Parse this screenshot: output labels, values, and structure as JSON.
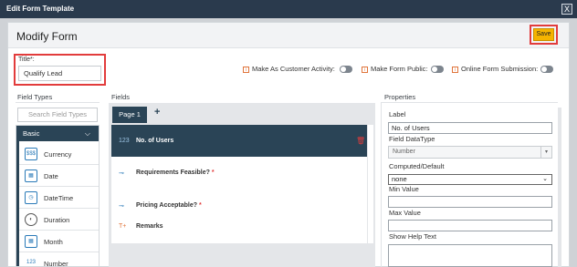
{
  "window": {
    "title": "Edit Form Template",
    "close_glyph": "X"
  },
  "header": {
    "page_title": "Modify Form",
    "save_label": "Save"
  },
  "form_title": {
    "label": "Title*:",
    "value": "Qualify Lead"
  },
  "options": [
    {
      "label": "Make As Customer Activity:",
      "icon": "info-icon",
      "enabled": false
    },
    {
      "label": "Make Form Public:",
      "icon": "info-icon",
      "enabled": false
    },
    {
      "label": "Online Form Submission:",
      "icon": "info-icon",
      "enabled": false
    }
  ],
  "field_types": {
    "title": "Field Types",
    "search_placeholder": "Search Field Types",
    "group_label": "Basic",
    "items": [
      {
        "label": "Currency",
        "icon": "currency-icon",
        "glyph": "$$$"
      },
      {
        "label": "Date",
        "icon": "calendar-icon",
        "glyph": "▦"
      },
      {
        "label": "DateTime",
        "icon": "clock-icon",
        "glyph": "◷"
      },
      {
        "label": "Duration",
        "icon": "duration-icon",
        "glyph": "◐"
      },
      {
        "label": "Month",
        "icon": "month-calendar-icon",
        "glyph": "▦"
      },
      {
        "label": "Number",
        "icon": "number-icon",
        "glyph": "123"
      }
    ]
  },
  "fields": {
    "title": "Fields",
    "page_tab": "Page 1",
    "add_glyph": "+",
    "rows": [
      {
        "label": "No. of Users",
        "icon_text": "123",
        "required": false,
        "selected": true
      },
      {
        "label": "Requirements Feasible?",
        "icon_text": "⊸",
        "required": true,
        "selected": false
      },
      {
        "label": "Pricing Acceptable?",
        "icon_text": "⊸",
        "required": true,
        "selected": false
      },
      {
        "label": "Remarks",
        "icon_text": "T+",
        "required": false,
        "selected": false
      }
    ],
    "required_marker": "*",
    "delete_glyph": "🗑"
  },
  "properties": {
    "title": "Properties",
    "label_label": "Label",
    "label_value": "No. of Users",
    "datatype_label": "Field DataType",
    "datatype_value": "Number",
    "computed_label": "Computed/Default",
    "computed_value": "none",
    "min_label": "Min Value",
    "max_label": "Max Value",
    "help_label": "Show Help Text"
  },
  "colors": {
    "accent": "#2a4456",
    "save": "#f5b400",
    "highlight": "#e23c3c",
    "titlebar": "#2a3a4d"
  }
}
